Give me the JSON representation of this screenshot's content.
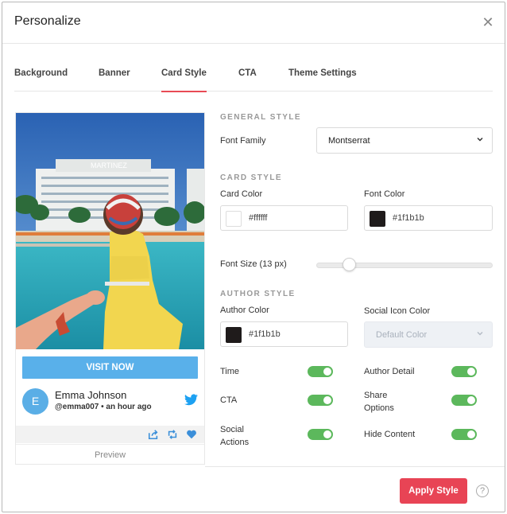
{
  "modal": {
    "title": "Personalize"
  },
  "tabs": [
    {
      "label": "Background"
    },
    {
      "label": "Banner"
    },
    {
      "label": "Card Style",
      "active": true
    },
    {
      "label": "CTA"
    },
    {
      "label": "Theme Settings"
    }
  ],
  "preview": {
    "photo_sign": "MARTINEZ",
    "cta_label": "VISIT NOW",
    "avatar_initial": "E",
    "author_name": "Emma Johnson",
    "author_meta": "@emma007 • an hour ago",
    "footer_label": "Preview"
  },
  "general_style": {
    "title": "GENERAL STYLE",
    "font_family_label": "Font Family",
    "font_family_value": "Montserrat"
  },
  "card_style": {
    "title": "CARD STYLE",
    "card_color_label": "Card Color",
    "card_color_value": "#ffffff",
    "font_color_label": "Font Color",
    "font_color_value": "#1f1b1b",
    "font_size_label": "Font Size (13 px)",
    "font_size_px": 13
  },
  "author_style": {
    "title": "AUTHOR STYLE",
    "author_color_label": "Author Color",
    "author_color_value": "#1f1b1b",
    "social_icon_color_label": "Social Icon Color",
    "social_icon_color_placeholder": "Default Color"
  },
  "toggles": {
    "time": {
      "label": "Time",
      "on": true
    },
    "author_detail": {
      "label": "Author Detail",
      "on": true
    },
    "cta": {
      "label": "CTA",
      "on": true
    },
    "share_options": {
      "label": "Share Options",
      "on": true
    },
    "social_actions": {
      "label": "Social Actions",
      "on": true
    },
    "hide_content": {
      "label": "Hide Content",
      "on": true
    }
  },
  "footer": {
    "apply_label": "Apply Style",
    "help_glyph": "?"
  },
  "colors": {
    "accent": "#e84455",
    "cta_blue": "#59b0ea",
    "toggle_on": "#5cb85c",
    "twitter": "#1da1f2"
  },
  "icons": [
    "close-icon",
    "chevron-down-icon",
    "twitter-icon",
    "share-icon",
    "retweet-icon",
    "heart-icon",
    "help-icon"
  ]
}
